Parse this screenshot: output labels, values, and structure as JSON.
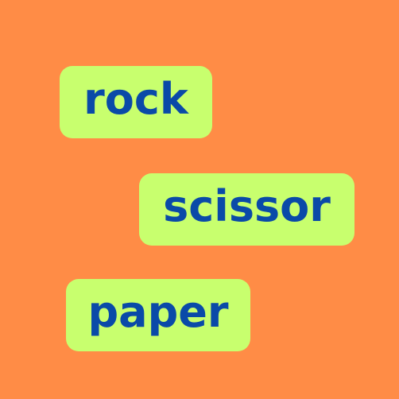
{
  "words": [
    "rock",
    "scissor",
    "paper"
  ],
  "colors": {
    "background": "#ff8c46",
    "pill": "#c8ff6e",
    "text": "#0a4aa8"
  }
}
